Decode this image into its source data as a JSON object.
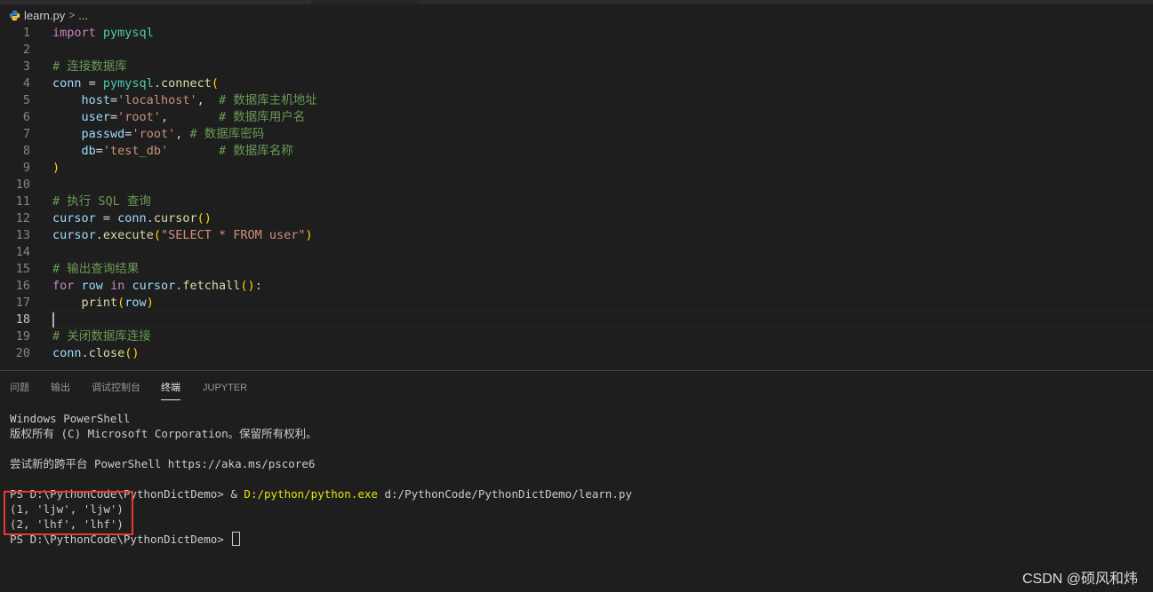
{
  "breadcrumb": {
    "file": "learn.py",
    "separator": ">",
    "more": "..."
  },
  "editor": {
    "current_line": 18,
    "lines": [
      {
        "n": "1",
        "tokens": [
          [
            "k",
            "import"
          ],
          [
            "p",
            " "
          ],
          [
            "m",
            "pymysql"
          ]
        ]
      },
      {
        "n": "2",
        "tokens": []
      },
      {
        "n": "3",
        "tokens": [
          [
            "c",
            "# 连接数据库"
          ]
        ]
      },
      {
        "n": "4",
        "tokens": [
          [
            "v",
            "conn"
          ],
          [
            "p",
            " = "
          ],
          [
            "m",
            "pymysql"
          ],
          [
            "p",
            "."
          ],
          [
            "f",
            "connect"
          ],
          [
            "b1",
            "("
          ]
        ]
      },
      {
        "n": "5",
        "tokens": [
          [
            "p",
            "    "
          ],
          [
            "v",
            "host"
          ],
          [
            "p",
            "="
          ],
          [
            "s",
            "'localhost'"
          ],
          [
            "p",
            ",  "
          ],
          [
            "c",
            "# 数据库主机地址"
          ]
        ]
      },
      {
        "n": "6",
        "tokens": [
          [
            "p",
            "    "
          ],
          [
            "v",
            "user"
          ],
          [
            "p",
            "="
          ],
          [
            "s",
            "'root'"
          ],
          [
            "p",
            ",       "
          ],
          [
            "c",
            "# 数据库用户名"
          ]
        ]
      },
      {
        "n": "7",
        "tokens": [
          [
            "p",
            "    "
          ],
          [
            "v",
            "passwd"
          ],
          [
            "p",
            "="
          ],
          [
            "s",
            "'root'"
          ],
          [
            "p",
            ", "
          ],
          [
            "c",
            "# 数据库密码"
          ]
        ]
      },
      {
        "n": "8",
        "tokens": [
          [
            "p",
            "    "
          ],
          [
            "v",
            "db"
          ],
          [
            "p",
            "="
          ],
          [
            "s",
            "'test_db'"
          ],
          [
            "p",
            "       "
          ],
          [
            "c",
            "# 数据库名称"
          ]
        ]
      },
      {
        "n": "9",
        "tokens": [
          [
            "b1",
            ")"
          ]
        ]
      },
      {
        "n": "10",
        "tokens": []
      },
      {
        "n": "11",
        "tokens": [
          [
            "c",
            "# 执行 SQL 查询"
          ]
        ]
      },
      {
        "n": "12",
        "tokens": [
          [
            "v",
            "cursor"
          ],
          [
            "p",
            " = "
          ],
          [
            "v",
            "conn"
          ],
          [
            "p",
            "."
          ],
          [
            "f",
            "cursor"
          ],
          [
            "b1",
            "()"
          ]
        ]
      },
      {
        "n": "13",
        "tokens": [
          [
            "v",
            "cursor"
          ],
          [
            "p",
            "."
          ],
          [
            "f",
            "execute"
          ],
          [
            "b1",
            "("
          ],
          [
            "s",
            "\"SELECT * FROM user\""
          ],
          [
            "b1",
            ")"
          ]
        ]
      },
      {
        "n": "14",
        "tokens": []
      },
      {
        "n": "15",
        "tokens": [
          [
            "c",
            "# 输出查询结果"
          ]
        ]
      },
      {
        "n": "16",
        "tokens": [
          [
            "k",
            "for"
          ],
          [
            "p",
            " "
          ],
          [
            "v",
            "row"
          ],
          [
            "p",
            " "
          ],
          [
            "k",
            "in"
          ],
          [
            "p",
            " "
          ],
          [
            "v",
            "cursor"
          ],
          [
            "p",
            "."
          ],
          [
            "f",
            "fetchall"
          ],
          [
            "b1",
            "()"
          ],
          [
            "p",
            ":"
          ]
        ]
      },
      {
        "n": "17",
        "tokens": [
          [
            "p",
            "    "
          ],
          [
            "f",
            "print"
          ],
          [
            "b1",
            "("
          ],
          [
            "v",
            "row"
          ],
          [
            "b1",
            ")"
          ]
        ]
      },
      {
        "n": "18",
        "tokens": []
      },
      {
        "n": "19",
        "tokens": [
          [
            "c",
            "# 关闭数据库连接"
          ]
        ]
      },
      {
        "n": "20",
        "tokens": [
          [
            "v",
            "conn"
          ],
          [
            "p",
            "."
          ],
          [
            "f",
            "close"
          ],
          [
            "b1",
            "()"
          ]
        ]
      }
    ]
  },
  "panel": {
    "tabs": [
      "问题",
      "输出",
      "调试控制台",
      "终端",
      "JUPYTER"
    ],
    "active_tab": "终端"
  },
  "terminal": {
    "line1": "Windows PowerShell",
    "line2": "版权所有 (C) Microsoft Corporation。保留所有权利。",
    "line3": "尝试新的跨平台 PowerShell https://aka.ms/pscore6",
    "prompt": "PS D:\\PythonCode\\PythonDictDemo> ",
    "command_amp": "& ",
    "command_exe": "D:/python/python.exe",
    "command_arg": " d:/PythonCode/PythonDictDemo/learn.py",
    "out1": "(1, 'ljw', 'ljw')",
    "out2": "(2, 'lhf', 'lhf')"
  },
  "watermark": "CSDN @硕风和炜",
  "colors": {
    "background": "#1e1e1e",
    "keyword": "#c586c0",
    "module": "#4ec9b0",
    "function": "#dcdcaa",
    "variable": "#9cdcfe",
    "string": "#ce9178",
    "comment": "#6a9955",
    "highlight_box": "#e53935"
  }
}
